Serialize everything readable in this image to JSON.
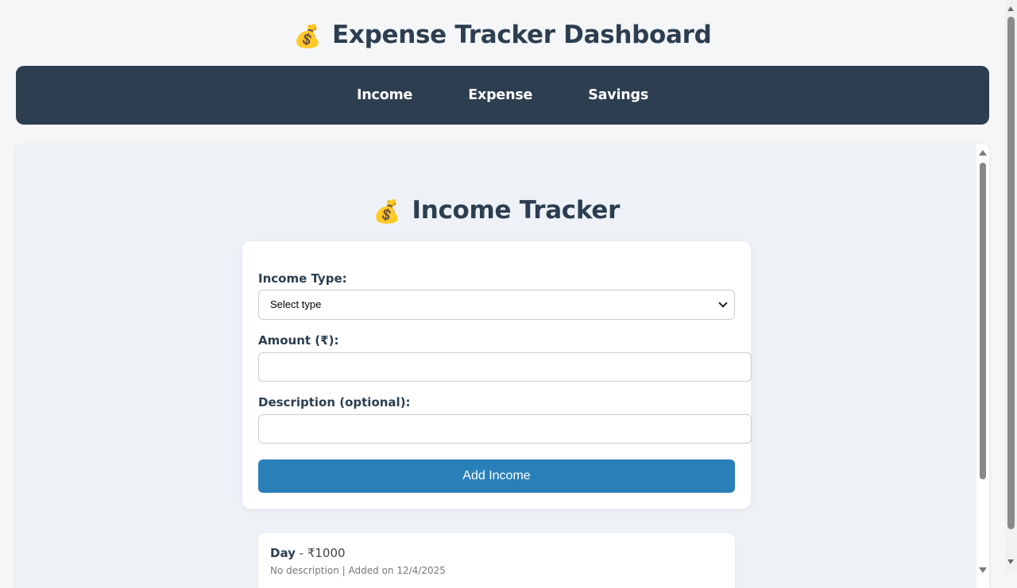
{
  "header": {
    "icon": "money-bag-icon",
    "emoji": "💰",
    "title": "Expense Tracker Dashboard"
  },
  "nav": {
    "items": [
      {
        "label": "Income"
      },
      {
        "label": "Expense"
      },
      {
        "label": "Savings"
      }
    ]
  },
  "income_tracker": {
    "icon": "money-bag-icon",
    "emoji": "💰",
    "title": "Income Tracker",
    "form": {
      "type_label": "Income Type:",
      "type_selected": "Select type",
      "amount_label": "Amount (₹):",
      "amount_value": "",
      "description_label": "Description (optional):",
      "description_value": "",
      "submit_label": "Add Income"
    },
    "entries": [
      {
        "type": "Day",
        "separator": " - ",
        "amount": "₹1000",
        "meta": "No description | Added on 12/4/2025"
      }
    ]
  },
  "colors": {
    "nav_background": "#2c3e50",
    "primary_button": "#2980b9",
    "heading_text": "#2c3e50",
    "page_background": "#f4f6f8",
    "content_background": "#eef2f7"
  }
}
